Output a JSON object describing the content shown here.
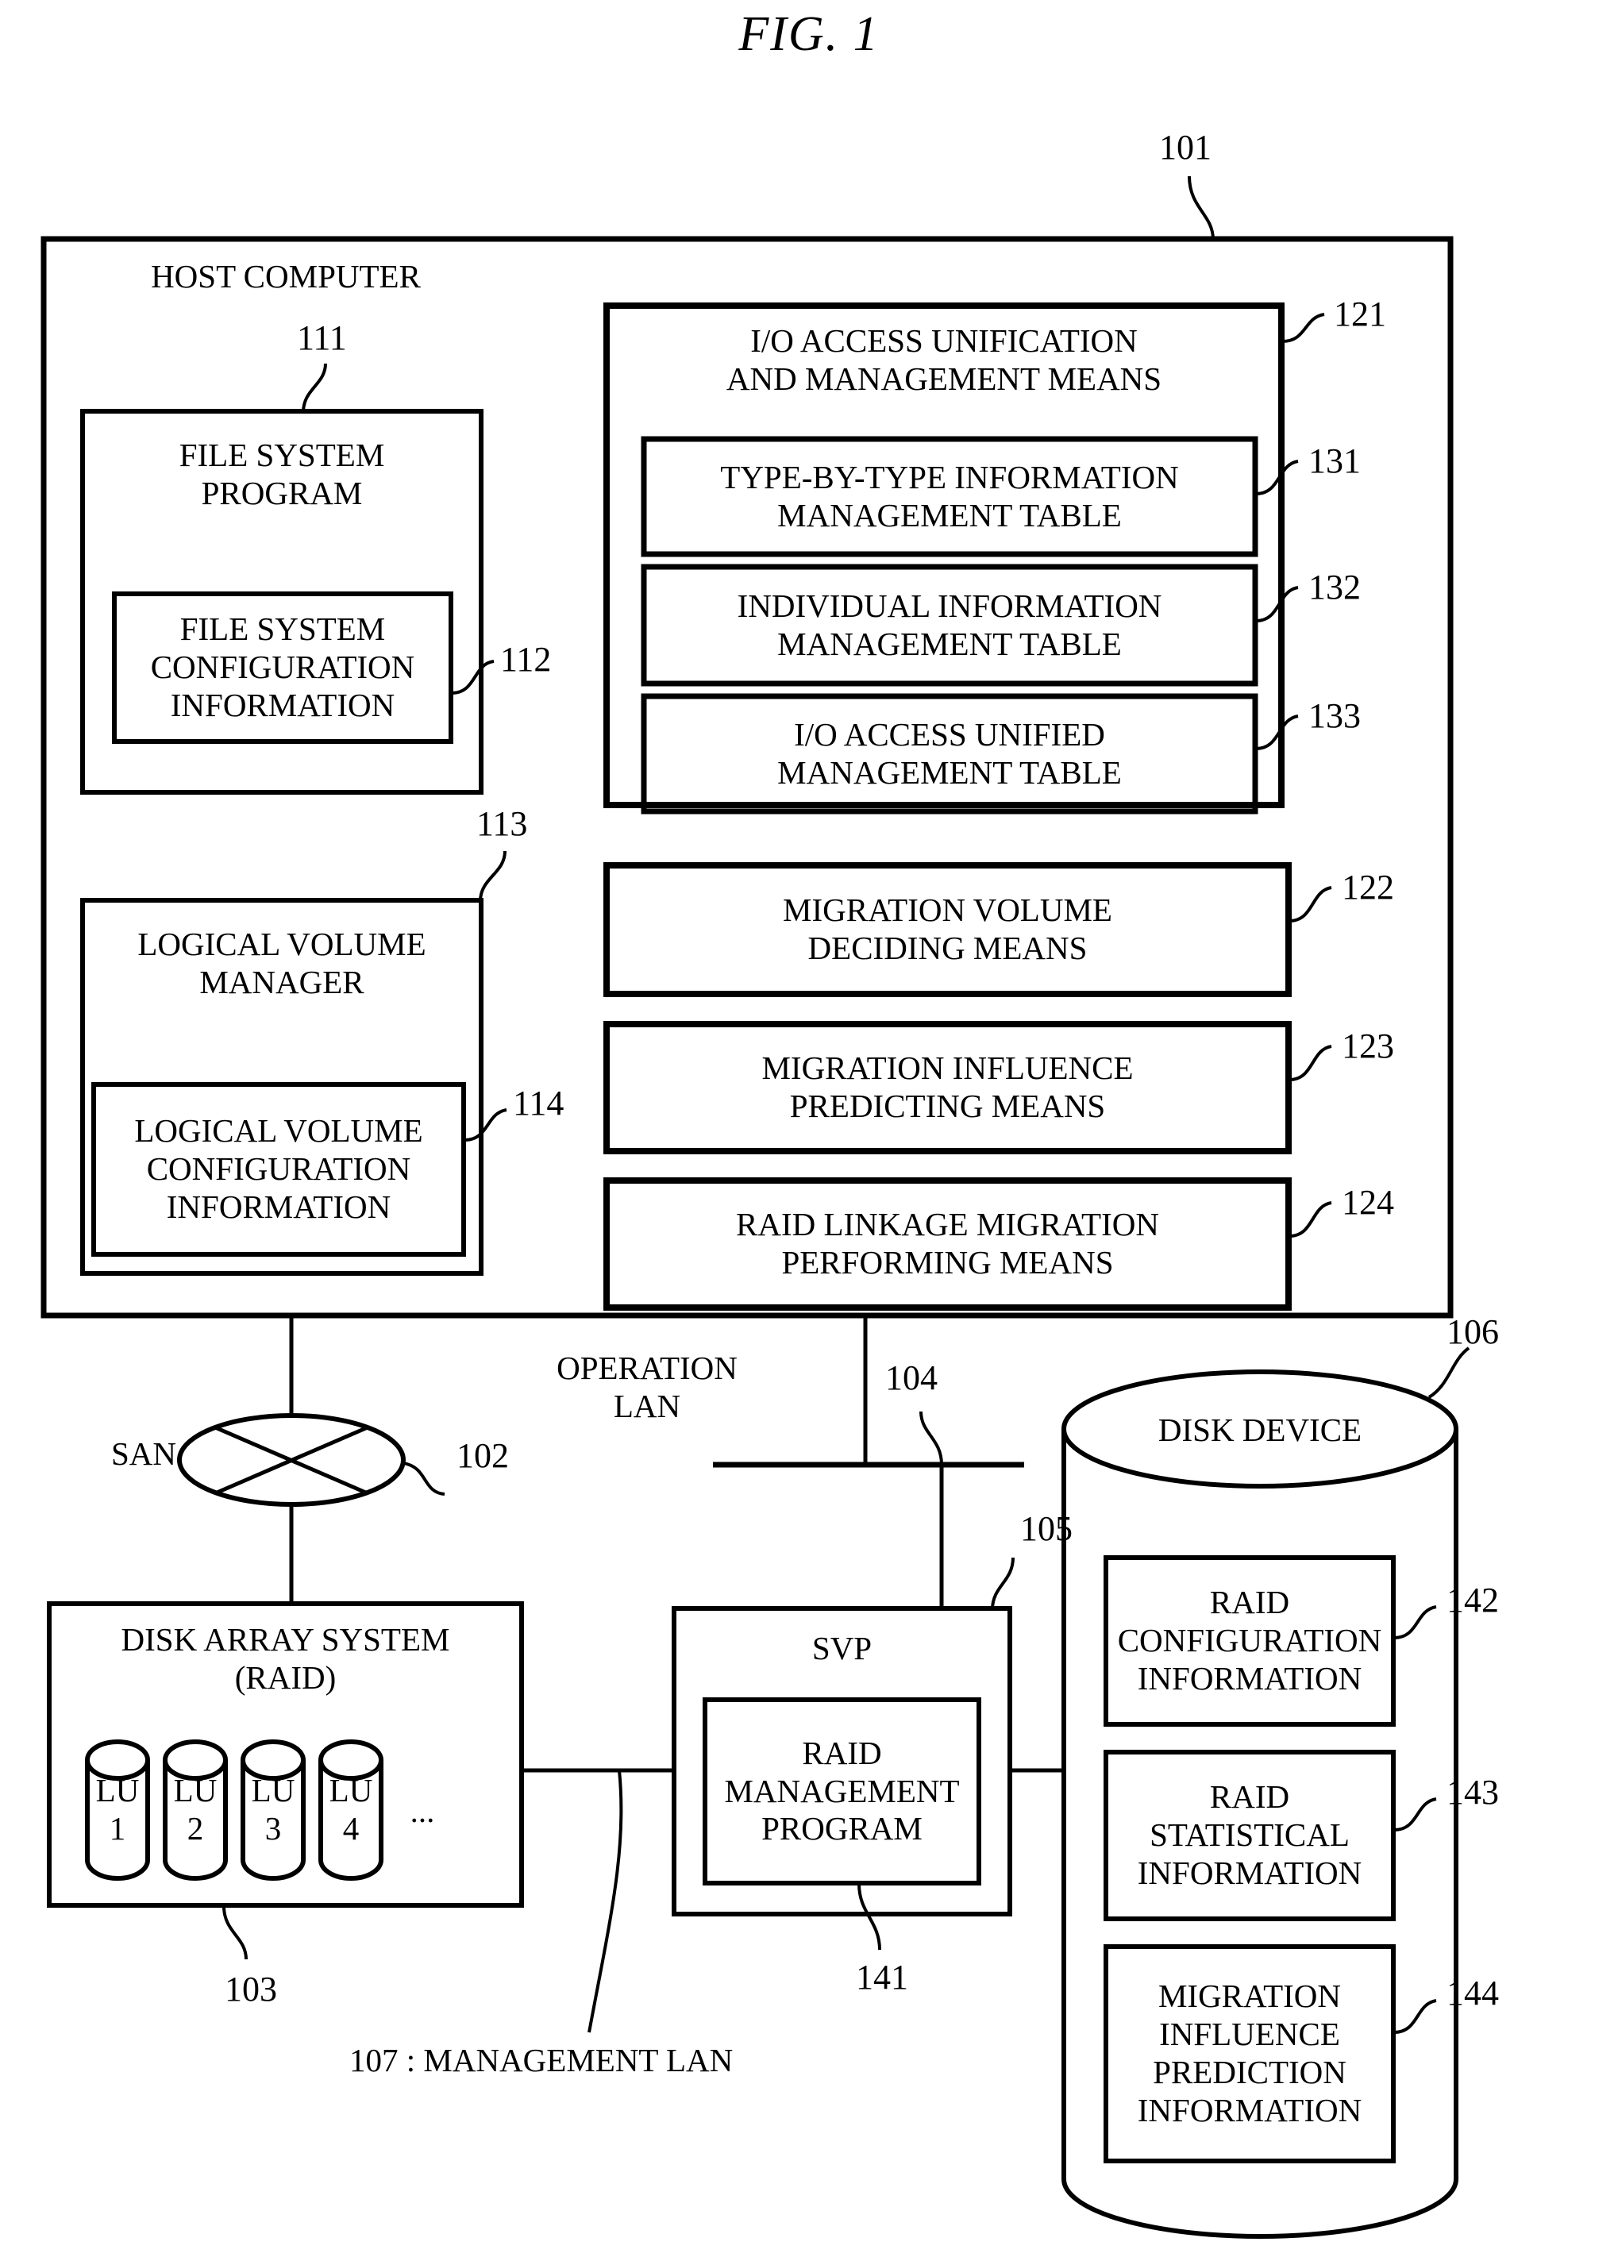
{
  "figure": {
    "title": "FIG.  1"
  },
  "host_computer": {
    "label": "HOST COMPUTER",
    "ref": "101",
    "file_system_program": {
      "label": "FILE SYSTEM\nPROGRAM",
      "ref": "111",
      "config": {
        "label": "FILE SYSTEM\nCONFIGURATION\nINFORMATION",
        "ref": "112"
      }
    },
    "logical_volume_manager": {
      "label": "LOGICAL VOLUME\nMANAGER",
      "ref": "113",
      "config": {
        "label": "LOGICAL VOLUME\nCONFIGURATION\nINFORMATION",
        "ref": "114"
      }
    },
    "io_access_means": {
      "label": "I/O ACCESS UNIFICATION\nAND MANAGEMENT MEANS",
      "ref": "121",
      "tables": [
        {
          "label": "TYPE-BY-TYPE INFORMATION\nMANAGEMENT TABLE",
          "ref": "131"
        },
        {
          "label": "INDIVIDUAL INFORMATION\nMANAGEMENT TABLE",
          "ref": "132"
        },
        {
          "label": "I/O ACCESS UNIFIED\nMANAGEMENT TABLE",
          "ref": "133"
        }
      ]
    },
    "means": [
      {
        "label": "MIGRATION VOLUME\nDECIDING MEANS",
        "ref": "122"
      },
      {
        "label": "MIGRATION INFLUENCE\nPREDICTING MEANS",
        "ref": "123"
      },
      {
        "label": "RAID LINKAGE MIGRATION\nPERFORMING MEANS",
        "ref": "124"
      }
    ]
  },
  "san": {
    "label": "SAN",
    "ref": "102"
  },
  "operation_lan": {
    "label": "OPERATION\nLAN",
    "ref": "104"
  },
  "management_lan": {
    "label": "107 : MANAGEMENT LAN"
  },
  "disk_array_system": {
    "label": "DISK ARRAY SYSTEM\n(RAID)",
    "ref": "103",
    "logical_units": [
      {
        "label": "LU\n1"
      },
      {
        "label": "LU\n2"
      },
      {
        "label": "LU\n3"
      },
      {
        "label": "LU\n4"
      }
    ],
    "ellipsis": "..."
  },
  "svp": {
    "label": "SVP",
    "ref": "105",
    "raid_management_program": {
      "label": "RAID\nMANAGEMENT\nPROGRAM",
      "ref": "141"
    }
  },
  "disk_device": {
    "label": "DISK DEVICE",
    "ref": "106",
    "contents": [
      {
        "label": "RAID\nCONFIGURATION\nINFORMATION",
        "ref": "142"
      },
      {
        "label": "RAID\nSTATISTICAL\nINFORMATION",
        "ref": "143"
      },
      {
        "label": "MIGRATION\nINFLUENCE\nPREDICTION\nINFORMATION",
        "ref": "144"
      }
    ]
  }
}
